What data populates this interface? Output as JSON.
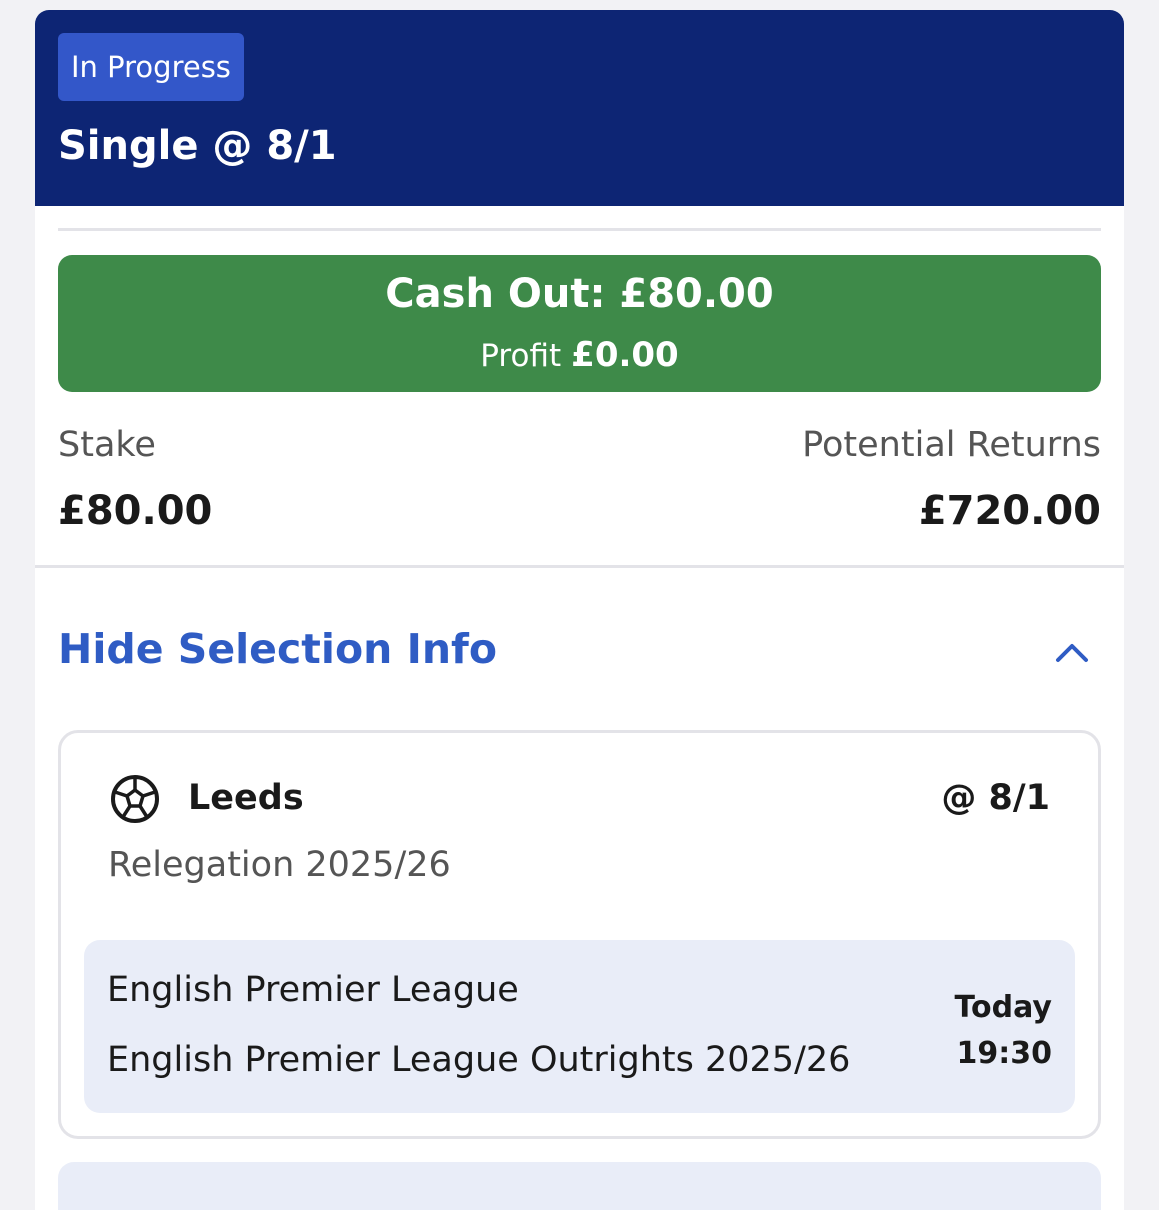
{
  "header": {
    "status_badge": "In Progress",
    "bet_title": "Single @ 8/1"
  },
  "cash_out": {
    "label": "Cash Out: £80.00",
    "profit_label": "Profit",
    "profit_value": "£0.00"
  },
  "stake": {
    "label": "Stake",
    "value": "£80.00"
  },
  "potential_returns": {
    "label": "Potential Returns",
    "value": "£720.00"
  },
  "selection_toggle": {
    "label": "Hide Selection Info",
    "icon": "chevron-up-icon"
  },
  "selection": {
    "sport_icon": "football-icon",
    "team": "Leeds",
    "odds": "@ 8/1",
    "market": "Relegation 2025/26",
    "league": "English Premier League",
    "event": "English Premier League Outrights 2025/26",
    "day": "Today",
    "time": "19:30"
  },
  "colors": {
    "header_bg": "#0d2574",
    "badge_bg": "#3357c9",
    "cashout_bg": "#3e8a49",
    "link": "#2f5cc4",
    "event_bg": "#e9edf8"
  }
}
